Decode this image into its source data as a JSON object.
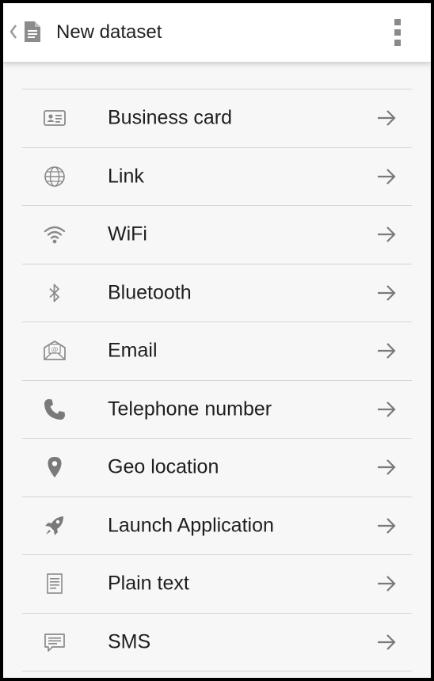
{
  "appbar": {
    "title": "New dataset",
    "back_icon": "chevron-left-icon",
    "app_icon": "document-icon",
    "menu_icon": "overflow-menu-icon"
  },
  "colors": {
    "appbar_bg": "#ffffff",
    "screen_bg": "#f7f7f7",
    "divider": "#d6d6d6",
    "icon": "#8a8a8a",
    "text": "#1e1e1e"
  },
  "list": {
    "items": [
      {
        "label": "Business card",
        "icon": "business-card-icon"
      },
      {
        "label": "Link",
        "icon": "globe-icon"
      },
      {
        "label": "WiFi",
        "icon": "wifi-icon"
      },
      {
        "label": "Bluetooth",
        "icon": "bluetooth-icon"
      },
      {
        "label": "Email",
        "icon": "email-icon"
      },
      {
        "label": "Telephone number",
        "icon": "phone-icon"
      },
      {
        "label": "Geo location",
        "icon": "location-pin-icon"
      },
      {
        "label": "Launch Application",
        "icon": "rocket-icon"
      },
      {
        "label": "Plain text",
        "icon": "plain-text-icon"
      },
      {
        "label": "SMS",
        "icon": "sms-icon"
      }
    ],
    "arrow_icon": "arrow-right-icon"
  }
}
